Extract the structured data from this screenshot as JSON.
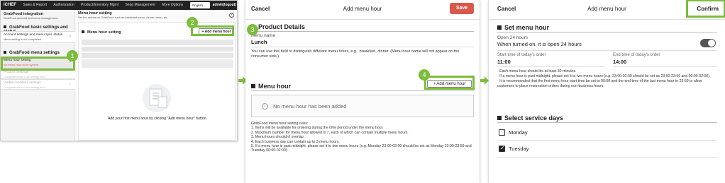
{
  "accent_color": "#7cbd3b",
  "panel1": {
    "nav": {
      "logo": "iCHEF",
      "items": [
        "Sales & Report",
        "Authorization",
        "Product/Inventory Mgmt",
        "Shop Management",
        "More Options"
      ],
      "language": "English",
      "user": "admin(logout)"
    },
    "sidebar": {
      "title": "GrabFood integration",
      "subtitle": "GrabFood account and menu management",
      "basic_header": "GrabFood basic settings and status",
      "account_item": "Account settings and menu sync status",
      "account_sub": "Menu setting is not completed",
      "menu_header": "GrabFood menu settings",
      "menu_hour_item": "Menu hour setting",
      "menu_hour_sub": "No menu hour to be synced",
      "product_item": "Product Settings",
      "product_sub": "Complete menu hour setting first",
      "modifier_item": "Visible modifiers settings",
      "modifier_sub": "Complete menu hour setting first"
    },
    "main": {
      "title": "Menu hour setting",
      "subtitle": "Set the menus on GrabFood such as breakfast menu, dinner menu, etc.",
      "section": "Menu hour setting",
      "add_button": "+ Add menu hour",
      "empty_text": "Add your first menu hour by clicking \"Add menu hour\" button."
    },
    "badges": [
      "1",
      "2"
    ]
  },
  "panel2": {
    "cancel": "Cancel",
    "title": "Add menu hour",
    "save": "Save",
    "product_details": "Product Details",
    "menu_name_label": "Menu name",
    "menu_name_value": "Lunch",
    "menu_name_hint": "You can use this field to distinguish different menu hours, e.g., breakfast, dinner. (Menu hour name will not appear on the consumer side.)",
    "menu_hour_header": "Menu hour",
    "add_button": "+ Add menu hour",
    "empty_text": "No menu hour has been added",
    "rules": [
      "GrabFood menu hour setting rules:",
      "1. Items will be available for ordering during the time period under the menu hour.",
      "2. Maximum number for menu hour allowed is 7, each of which can contain multiple menu hours.",
      "3. Menu hours shouldn't overlap.",
      "4. Each business day can contain up to 3 menu hours.",
      "5. If a menu hour is past midnight, please set it to two menu hours (e.g. Monday 23:00-02:00 should be set as Monday 23:00-23:59 and Tuesday 00:00-02:00)."
    ],
    "badges": [
      "3",
      "4"
    ]
  },
  "panel3": {
    "cancel": "Cancel",
    "title": "Add menu hour",
    "confirm": "Confirm",
    "set_header": "Set menu hour",
    "open24_label": "Open 24 hours",
    "open24_desc": "When turned on, it is open 24 hours",
    "start_label": "Start time of today's order",
    "start_value": "11:00",
    "end_label": "End time of today's order",
    "end_value": "14:00",
    "notes": [
      "· Each menu hour should be at least 30 minutes.",
      "· If a menu hour is past midnight, please set it to two menu hours (e.g. 23:00-02:00 should be set as 23:00-23:59 and 00:00-02:00).",
      "· It is recommended that the first menu hour start time be set to 00:00 and the end time of the last menu hour to 23:59 to allow customers to place reservation orders during non-business hours."
    ],
    "service_header": "Select service days",
    "days": [
      {
        "label": "Monday",
        "checked": false
      },
      {
        "label": "Tuesday",
        "checked": true
      }
    ]
  }
}
